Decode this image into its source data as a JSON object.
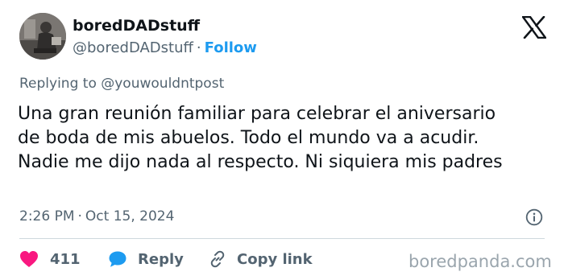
{
  "author": {
    "display_name": "boredDADstuff",
    "handle": "@boredDADstuff",
    "follow_label": "Follow",
    "avatar": "avatar-photo"
  },
  "platform_logo": "x-logo",
  "replying_to": {
    "prefix": "Replying to",
    "handle": "@youwouldntpost"
  },
  "body_lines": [
    "Una gran reunión familiar para celebrar el aniversario",
    "de boda de mis abuelos. Todo el mundo va a acudir.",
    "Nadie me dijo nada al respecto. Ni siquiera mis padres"
  ],
  "timestamp": {
    "time": "2:26 PM",
    "date": "Oct 15, 2024"
  },
  "actions": {
    "likes": "411",
    "reply_label": "Reply",
    "copy_link_label": "Copy link"
  },
  "icons": {
    "like": "heart-icon",
    "reply": "reply-bubble-icon",
    "copy": "link-icon",
    "info": "info-icon"
  },
  "colors": {
    "like": "#f91880",
    "reply": "#1d9bf0",
    "follow": "#1d9bf0",
    "muted": "#536471"
  },
  "watermark": "boredpanda.com"
}
